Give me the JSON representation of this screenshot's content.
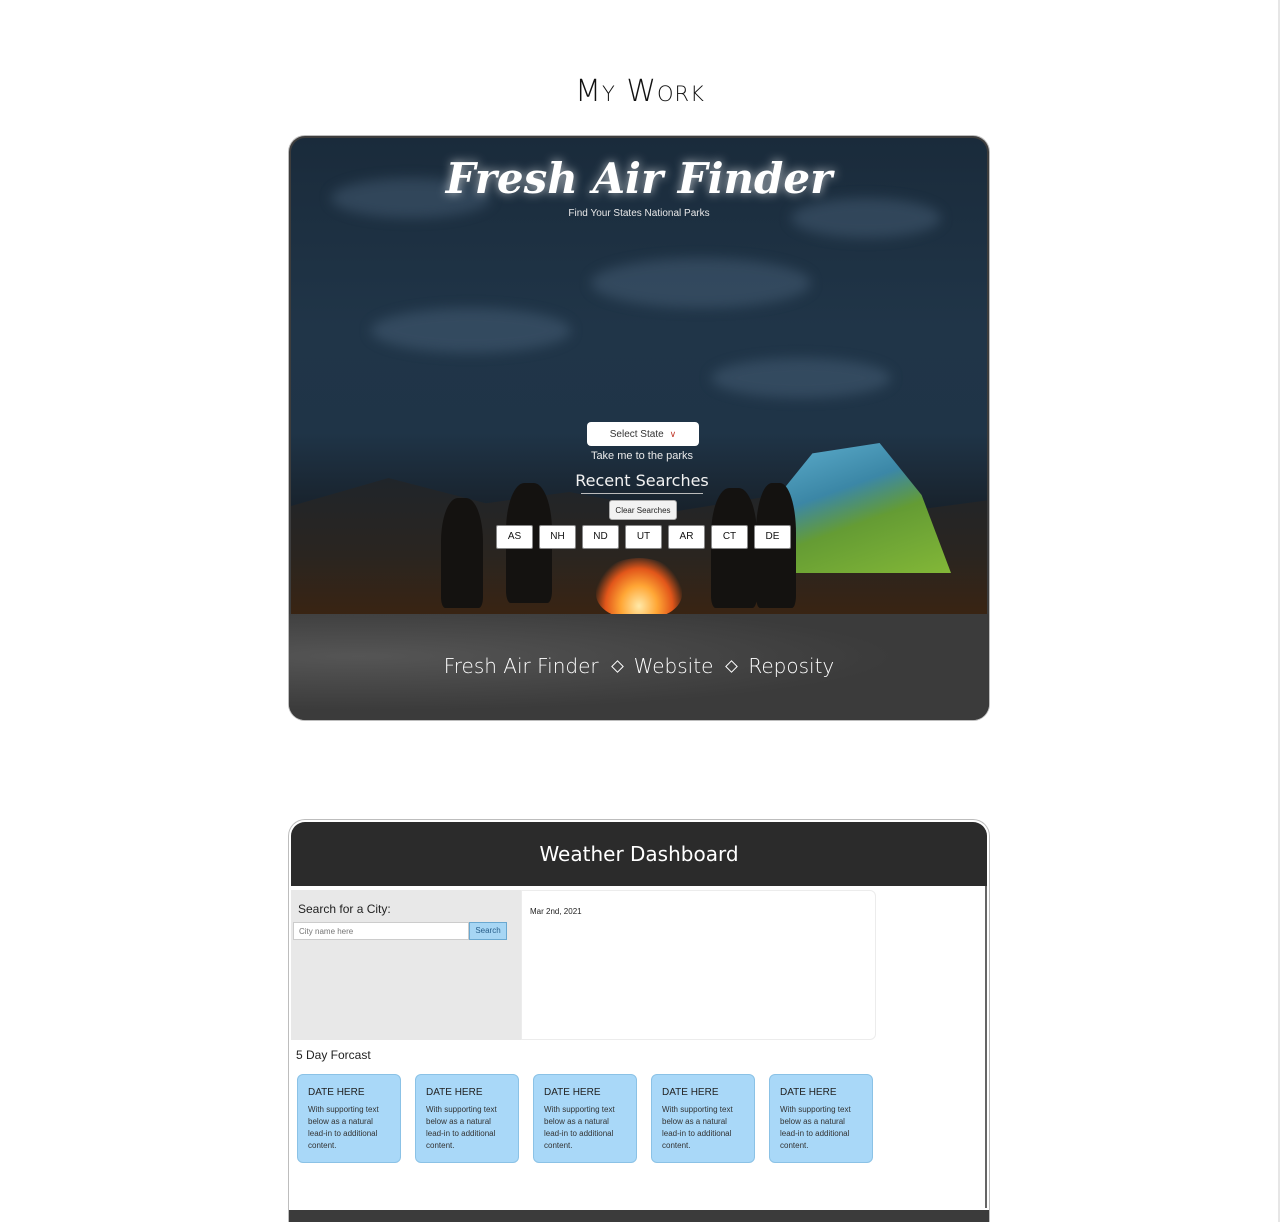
{
  "section": {
    "title": "My Work"
  },
  "project1": {
    "app_title": "Fresh Air Finder",
    "app_subtitle": "Find Your States National Parks",
    "select_placeholder": "Select State",
    "take_me": "Take me to the parks",
    "recent_heading": "Recent Searches",
    "clear_label": "Clear Searches",
    "states": [
      "AS",
      "NH",
      "ND",
      "UT",
      "AR",
      "CT",
      "DE"
    ],
    "footer": {
      "name": "Fresh Air Finder",
      "website": "Website",
      "repo": "Reposity"
    }
  },
  "project2": {
    "header": "Weather Dashboard",
    "search_label": "Search for a City:",
    "search_placeholder": "City name here",
    "search_button": "Search",
    "today_date": "Mar 2nd, 2021",
    "forecast_label": "5 Day Forcast",
    "forecast_cards": [
      {
        "title": "DATE HERE",
        "text": "With supporting text below as a natural lead-in to additional content."
      },
      {
        "title": "DATE HERE",
        "text": "With supporting text below as a natural lead-in to additional content."
      },
      {
        "title": "DATE HERE",
        "text": "With supporting text below as a natural lead-in to additional content."
      },
      {
        "title": "DATE HERE",
        "text": "With supporting text below as a natural lead-in to additional content."
      },
      {
        "title": "DATE HERE",
        "text": "With supporting text below as a natural lead-in to additional content."
      }
    ]
  }
}
